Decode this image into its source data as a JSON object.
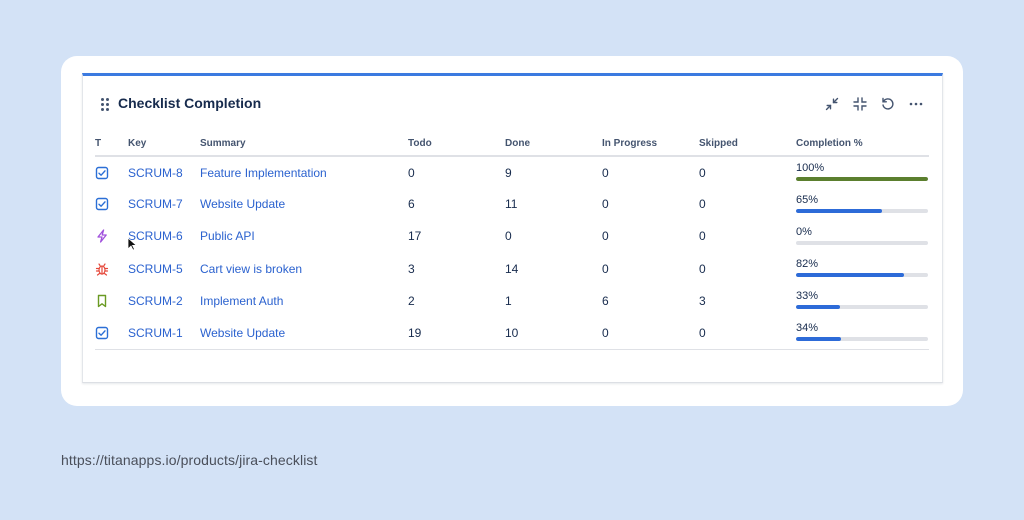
{
  "gadget": {
    "title": "Checklist Completion",
    "accent_color": "#3b7ae0",
    "actions": [
      {
        "name": "minimize-icon",
        "label": "Minimize"
      },
      {
        "name": "collapse-icon",
        "label": "Collapse"
      },
      {
        "name": "refresh-icon",
        "label": "Refresh"
      },
      {
        "name": "more-icon",
        "label": "More actions"
      }
    ]
  },
  "table": {
    "headers": {
      "type": "T",
      "key": "Key",
      "summary": "Summary",
      "todo": "Todo",
      "done": "Done",
      "in_progress": "In Progress",
      "skipped": "Skipped",
      "completion": "Completion %"
    },
    "rows": [
      {
        "type": "task",
        "type_icon": "task-checkbox-icon",
        "key": "SCRUM-8",
        "summary": "Feature Implementation",
        "todo": "0",
        "done": "9",
        "in_progress": "0",
        "skipped": "0",
        "completion": "100%",
        "progress": 1.0,
        "bar_color": "#5b7f2e"
      },
      {
        "type": "task",
        "type_icon": "task-checkbox-icon",
        "key": "SCRUM-7",
        "summary": "Website Update",
        "todo": "6",
        "done": "11",
        "in_progress": "0",
        "skipped": "0",
        "completion": "65%",
        "progress": 0.65,
        "bar_color": "#2d6bd8"
      },
      {
        "type": "epic",
        "type_icon": "lightning-icon",
        "key": "SCRUM-6",
        "summary": "Public API",
        "todo": "17",
        "done": "0",
        "in_progress": "0",
        "skipped": "0",
        "completion": "0%",
        "progress": 0.0,
        "bar_color": "#2d6bd8"
      },
      {
        "type": "bug",
        "type_icon": "bug-icon",
        "key": "SCRUM-5",
        "summary": "Cart view is broken",
        "todo": "3",
        "done": "14",
        "in_progress": "0",
        "skipped": "0",
        "completion": "82%",
        "progress": 0.82,
        "bar_color": "#2d6bd8"
      },
      {
        "type": "story",
        "type_icon": "bookmark-icon",
        "key": "SCRUM-2",
        "summary": "Implement Auth",
        "todo": "2",
        "done": "1",
        "in_progress": "6",
        "skipped": "3",
        "completion": "33%",
        "progress": 0.33,
        "bar_color": "#2d6bd8"
      },
      {
        "type": "task",
        "type_icon": "task-checkbox-icon",
        "key": "SCRUM-1",
        "summary": "Website Update",
        "todo": "19",
        "done": "10",
        "in_progress": "0",
        "skipped": "0",
        "completion": "34%",
        "progress": 0.34,
        "bar_color": "#2d6bd8"
      }
    ]
  },
  "colors": {
    "page_background": "#d3e2f6",
    "link": "#2b62cf",
    "task_icon": "#2b6fd6",
    "epic_icon": "#a050dc",
    "bug_icon": "#e5483b",
    "story_icon": "#6a9a23"
  },
  "footer": {
    "url": "https://titanapps.io/products/jira-checklist"
  }
}
